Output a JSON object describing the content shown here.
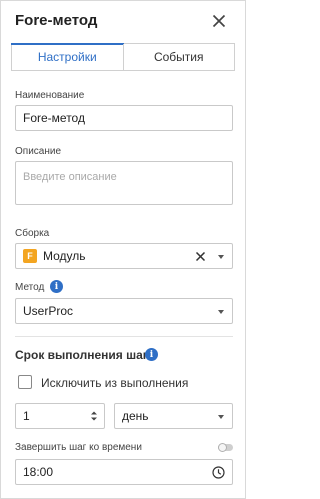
{
  "header": {
    "title": "Fore-метод",
    "close_icon": "close-icon"
  },
  "tabs": [
    {
      "label": "Настройки",
      "active": true
    },
    {
      "label": "События",
      "active": false
    }
  ],
  "fields": {
    "name": {
      "label": "Наименование",
      "value": "Fore-метод"
    },
    "description": {
      "label": "Описание",
      "placeholder": "Введите описание"
    },
    "assembly": {
      "label": "Сборка",
      "value": "Модуль",
      "icon_letter": "F"
    },
    "method": {
      "label": "Метод",
      "value": "UserProc"
    }
  },
  "step_time": {
    "title": "Срок выполнения шага",
    "exclude_label": "Исключить из выполнения",
    "exclude_checked": false,
    "amount": "1",
    "unit": "день",
    "finish_label": "Завершить шаг ко времени",
    "finish_enabled": false,
    "time": "18:00"
  },
  "colors": {
    "accent": "#2f6fc6",
    "module_icon": "#f3a521"
  }
}
